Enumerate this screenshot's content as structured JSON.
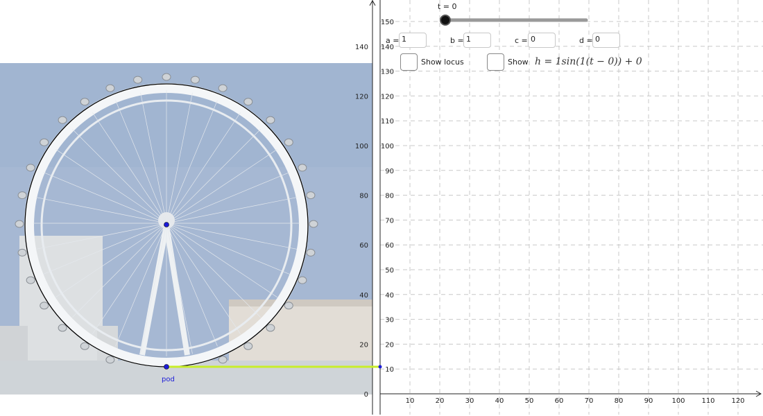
{
  "slider": {
    "label": "t = 0",
    "value": 0
  },
  "params": {
    "a": {
      "label": "a =",
      "value": "1"
    },
    "b": {
      "label": "b =",
      "value": "1"
    },
    "c": {
      "label": "c =",
      "value": "0"
    },
    "d": {
      "label": "d =",
      "value": "0"
    }
  },
  "checkboxes": {
    "locus": {
      "label": "Show locus",
      "checked": false
    },
    "equation": {
      "label": "Show",
      "checked": false
    }
  },
  "formula": "h = 1sin(1(t − 0)) + 0",
  "point_label": "pod",
  "axes": {
    "x_ticks": [
      "10",
      "20",
      "30",
      "40",
      "50",
      "60",
      "70",
      "80",
      "90",
      "100",
      "110",
      "120"
    ],
    "y_ticks": [
      "10",
      "20",
      "30",
      "40",
      "50",
      "60",
      "70",
      "80",
      "90",
      "100",
      "110",
      "120",
      "130",
      "140",
      "150"
    ],
    "left_y_ticks": [
      "0",
      "20",
      "40",
      "60",
      "80",
      "100",
      "120",
      "140"
    ]
  },
  "colors": {
    "sky": "#a6b8d3",
    "locus_line": "#c8ee2a",
    "point": "#1b1bd8",
    "grid": "#c8c8c8"
  }
}
